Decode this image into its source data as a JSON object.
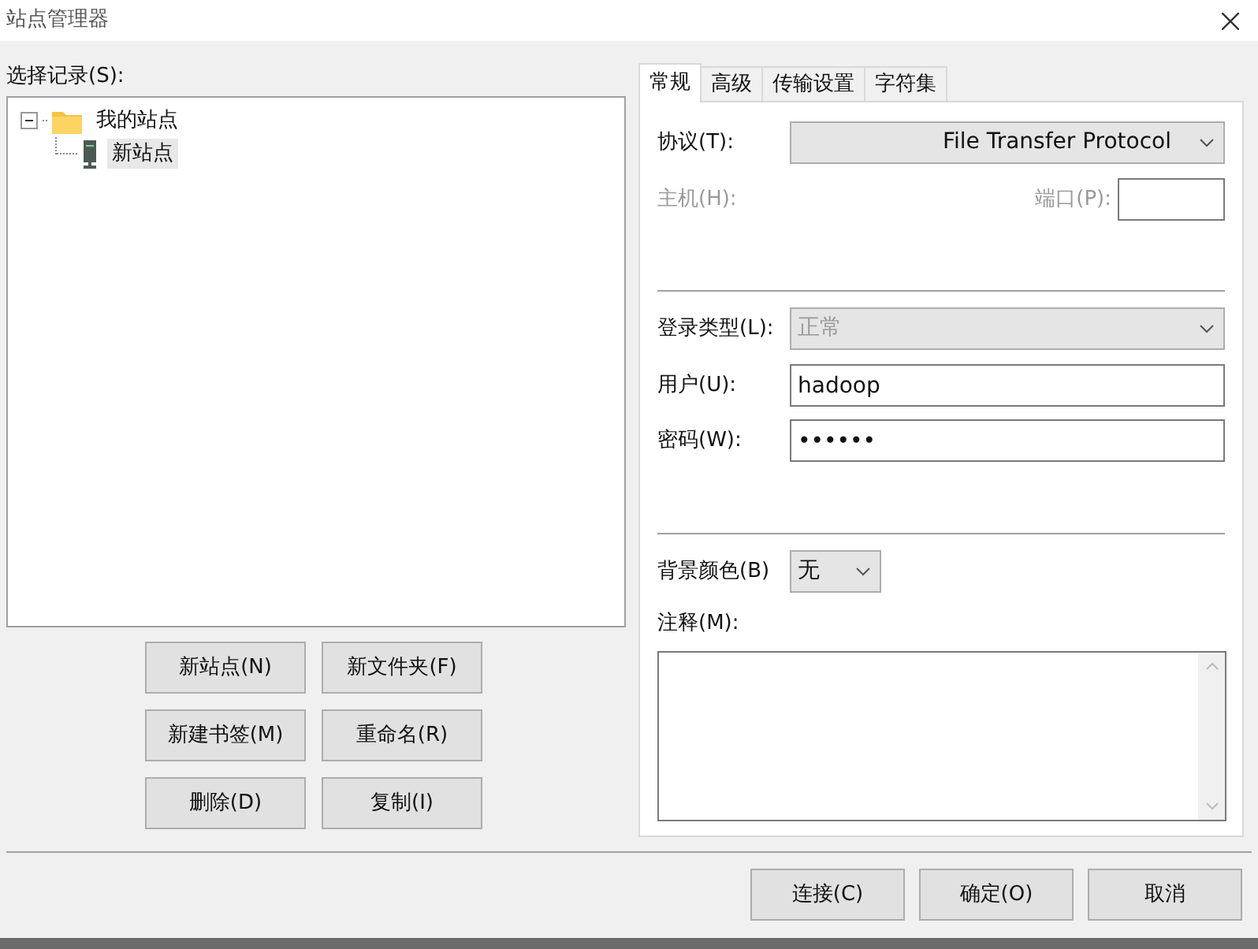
{
  "window": {
    "title": "站点管理器"
  },
  "site_tree": {
    "label": "选择记录(S):",
    "items": [
      {
        "name": "我的站点",
        "kind": "folder",
        "expanded": true,
        "selected": false,
        "children": [
          {
            "name": "新站点",
            "kind": "site",
            "selected": true
          }
        ]
      }
    ]
  },
  "tree_buttons": [
    "新站点(N)",
    "新文件夹(F)",
    "新建书签(M)",
    "重命名(R)",
    "删除(D)",
    "复制(I)"
  ],
  "tabs": [
    {
      "label": "常规",
      "selected": true
    },
    {
      "label": "高级",
      "selected": false
    },
    {
      "label": "传输设置",
      "selected": false
    },
    {
      "label": "字符集",
      "selected": false
    }
  ],
  "general": {
    "protocol": {
      "label": "协议(T):",
      "value": "File Transfer Protocol"
    },
    "host": {
      "label": "主机(H):"
    },
    "port": {
      "label": "端口(P):"
    },
    "logon_type": {
      "label": "登录类型(L):",
      "value": "正常"
    },
    "user": {
      "label": "用户(U):",
      "value": "hadoop"
    },
    "password": {
      "label": "密码(W):",
      "value": "••••••"
    },
    "background_color": {
      "label": "背景颜色(B)",
      "value": "无"
    },
    "comments": {
      "label": "注释(M):"
    }
  },
  "buttons": [
    "连接(C)",
    "确定(O)",
    "取消"
  ]
}
